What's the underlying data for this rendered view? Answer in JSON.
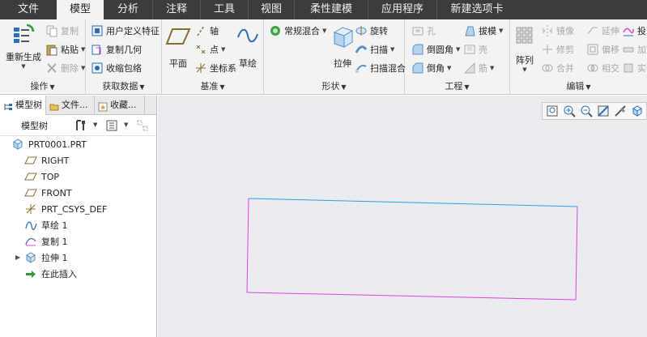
{
  "tabs": [
    "文件",
    "模型",
    "分析",
    "注释",
    "工具",
    "视图",
    "柔性建模",
    "应用程序",
    "新建选项卡"
  ],
  "active_tab": 1,
  "ribbon": {
    "ops": {
      "regenerate": "重新生成",
      "copy": "复制",
      "paste": "粘贴",
      "delete": "删除",
      "label": "操作"
    },
    "get_data": {
      "udf": "用户定义特征",
      "copy_geom": "复制几何",
      "shrinkwrap": "收缩包络",
      "label": "获取数据"
    },
    "datum": {
      "plane": "平面",
      "axis": "轴",
      "point": "点",
      "csys": "坐标系",
      "sketch": "草绘",
      "label": "基准"
    },
    "shapes": {
      "blend": "常规混合",
      "extrude": "拉伸",
      "revolve": "旋转",
      "sweep": "扫描",
      "swept_blend": "扫描混合",
      "label": "形状"
    },
    "engineering": {
      "hole": "孔",
      "draft": "拔模",
      "round": "倒圆角",
      "shell": "壳",
      "chamfer": "倒角",
      "rib": "筋",
      "label": "工程"
    },
    "editing": {
      "pattern": "阵列",
      "mirror": "镜像",
      "extend": "延伸",
      "project": "投影",
      "trim": "修剪",
      "offset": "偏移",
      "thicken": "加厚",
      "merge": "合并",
      "intersect": "相交",
      "solidify": "实体化",
      "label": "编辑"
    }
  },
  "panel": {
    "tabs": [
      "模型树",
      "文件...",
      "收藏..."
    ],
    "toolbar_title": "模型树",
    "tree": [
      {
        "label": "PRT0001.PRT",
        "icon": "part-icon"
      },
      {
        "label": "RIGHT",
        "icon": "datum-plane-icon"
      },
      {
        "label": "TOP",
        "icon": "datum-plane-icon"
      },
      {
        "label": "FRONT",
        "icon": "datum-plane-icon"
      },
      {
        "label": "PRT_CSYS_DEF",
        "icon": "csys-icon"
      },
      {
        "label": "草绘 1",
        "icon": "sketch-icon"
      },
      {
        "label": "复制 1",
        "icon": "copy-geometry-icon"
      },
      {
        "label": "拉伸 1",
        "icon": "extrude-icon"
      },
      {
        "label": "在此插入",
        "icon": "insert-here-icon"
      }
    ]
  },
  "colors": {
    "ribbon_bg": "#f3f3f3",
    "tabbar_bg": "#3c3c3c",
    "viewport_bg": "#e9ebef",
    "edge_blue": "#2aa0e6",
    "edge_magenta": "#e040e0"
  }
}
